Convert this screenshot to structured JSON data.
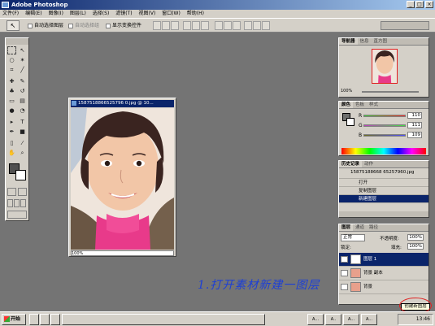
{
  "window": {
    "title": "Adobe Photoshop"
  },
  "menu": [
    "文件(F)",
    "编辑(E)",
    "图像(I)",
    "图层(L)",
    "选择(S)",
    "滤镜(T)",
    "视图(V)",
    "窗口(W)",
    "帮助(H)"
  ],
  "options": {
    "auto_select_layer": "自动选择图层",
    "auto_select_group": "自动选择组",
    "show_bounding_box": "显示变换控件"
  },
  "document": {
    "title": "1587518866525796 0.jpg @ 10...",
    "zoom": "100%"
  },
  "navigator": {
    "tabs": [
      "导航器",
      "信息",
      "直方图"
    ],
    "zoom": "100%"
  },
  "color": {
    "tabs": [
      "颜色",
      "色板",
      "样式"
    ],
    "r": "110",
    "g": "111",
    "b": "109",
    "labels": [
      "R",
      "G",
      "B"
    ]
  },
  "history": {
    "tabs": [
      "历史记录",
      "动作"
    ],
    "snapshot": "15875188668 65257960.jpg",
    "items": [
      "打开",
      "复制图层",
      "新建图层"
    ]
  },
  "layers": {
    "tabs": [
      "图层",
      "通道",
      "路径"
    ],
    "blend_mode": "正常",
    "opacity_label": "不透明度:",
    "opacity": "100%",
    "lock_label": "锁定:",
    "fill_label": "填充:",
    "fill": "100%",
    "rows": [
      "图层 1",
      "背景 副本",
      "背景"
    ]
  },
  "caption": "1.打开素材新建一图层",
  "tooltip": "创建新图层",
  "taskbar": {
    "start": "开始",
    "buttons": [
      "",
      "",
      "",
      "",
      "A...",
      "A..",
      "A...",
      "A..."
    ],
    "clock": "13:46"
  }
}
